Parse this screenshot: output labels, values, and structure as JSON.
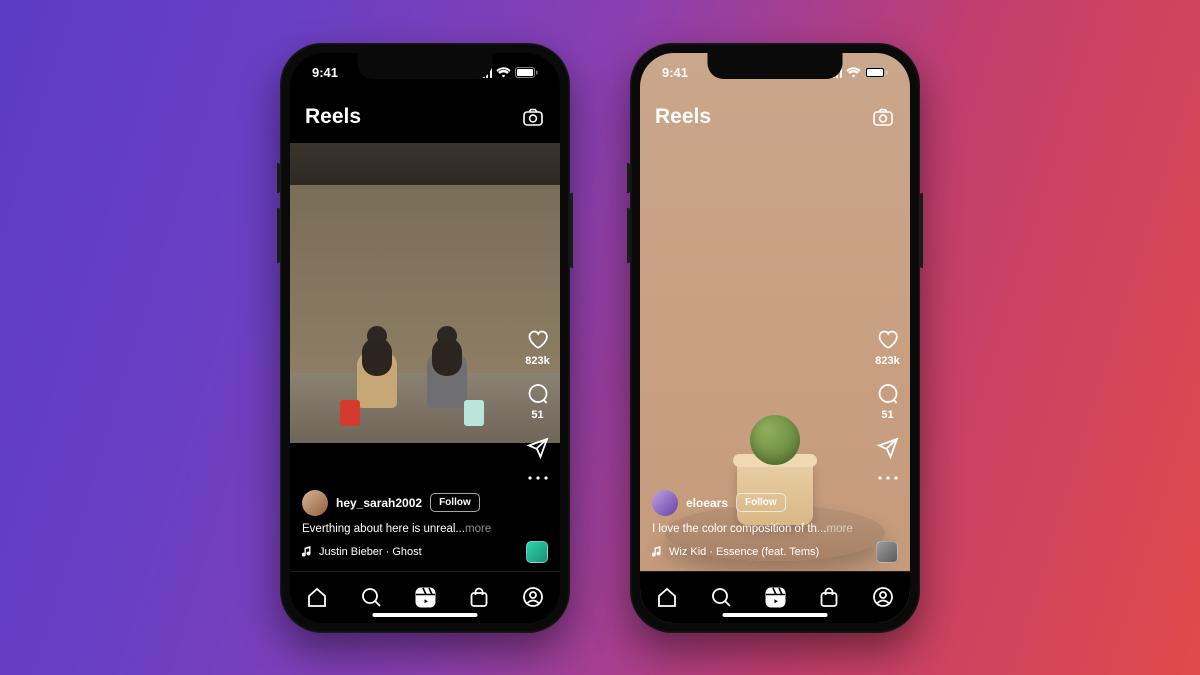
{
  "status": {
    "time": "9:41"
  },
  "header": {
    "title": "Reels"
  },
  "phones": [
    {
      "username": "hey_sarah2002",
      "follow_label": "Follow",
      "caption_text": "Everthing about here is unreal...",
      "caption_more": "more",
      "audio_text": "Justin Bieber · Ghost",
      "like_count": "823k",
      "comment_count": "51"
    },
    {
      "username": "eloears",
      "follow_label": "Follow",
      "caption_text": "I love the color composition of th...",
      "caption_more": "more",
      "audio_text": "Wiz Kid · Essence (feat. Tems)",
      "like_count": "823k",
      "comment_count": "51"
    }
  ]
}
